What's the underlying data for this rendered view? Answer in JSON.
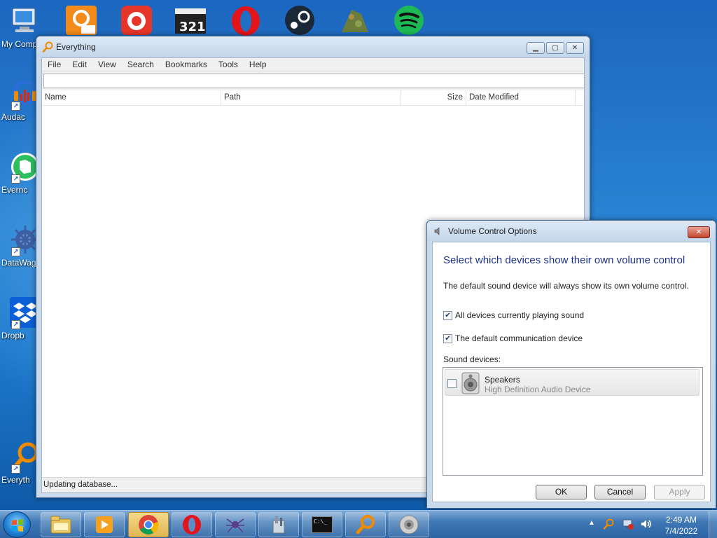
{
  "desktop": {
    "left_icons": [
      {
        "label": "My Comp",
        "icon": "computer-icon"
      },
      {
        "label": "Audac",
        "icon": "audacity-icon"
      },
      {
        "label": "Evernc",
        "icon": "evernote-icon"
      },
      {
        "label": "DataWag",
        "icon": "datawagon-icon"
      },
      {
        "label": "Dropb",
        "icon": "dropbox-icon"
      },
      {
        "label": "Everyth",
        "icon": "everything-icon"
      }
    ],
    "top_icons": [
      "foxit-pdf-icon",
      "gom-player-icon",
      "media-player-classic-icon",
      "opera-icon",
      "steam-icon",
      "game-icon",
      "spotify-icon"
    ]
  },
  "everything": {
    "title": "Everything",
    "menu": [
      "File",
      "Edit",
      "View",
      "Search",
      "Bookmarks",
      "Tools",
      "Help"
    ],
    "search_value": "",
    "columns": [
      "Name",
      "Path",
      "Size",
      "Date Modified"
    ],
    "status": "Updating database..."
  },
  "volume_options": {
    "title": "Volume Control Options",
    "heading": "Select which devices show their own volume control",
    "description": "The default sound device will always show its own volume control.",
    "checkbox_playing": {
      "label": "All devices currently playing sound",
      "checked": true
    },
    "checkbox_comm": {
      "label": "The default communication device",
      "checked": true
    },
    "sound_devices_label": "Sound devices:",
    "devices": [
      {
        "name": "Speakers",
        "subtitle": "High Definition Audio Device",
        "checked": false
      }
    ],
    "buttons": {
      "ok": "OK",
      "cancel": "Cancel",
      "apply": "Apply"
    }
  },
  "taskbar": {
    "pinned": [
      "explorer-icon",
      "media-player-icon",
      "chrome-icon",
      "opera-icon",
      "spider-icon",
      "tools-icon",
      "cmd-icon",
      "everything-icon",
      "speaker-icon"
    ],
    "active_index": 2,
    "cmd_text": "C:\\_",
    "clock_time": "2:49 AM",
    "clock_date": "7/4/2022"
  },
  "colors": {
    "heading_blue": "#1e3287",
    "desktop_blue": "#1f6fc4",
    "taskbar_active": "#e1b552"
  }
}
